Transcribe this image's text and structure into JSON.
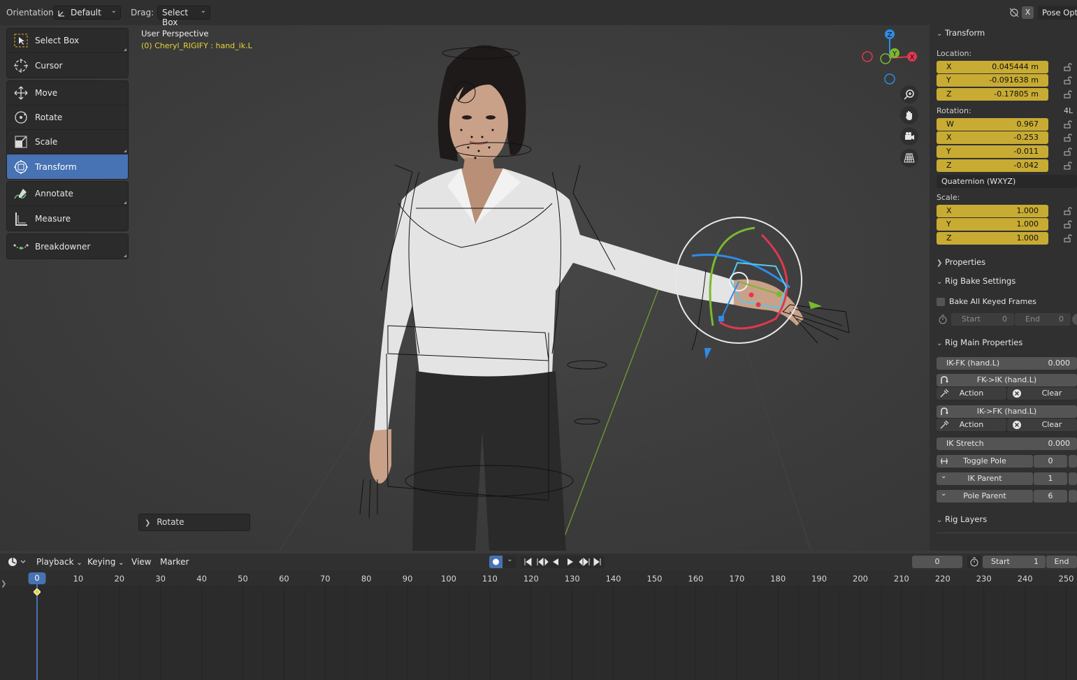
{
  "header": {
    "orientation_label": "Orientation:",
    "orientation_value": "Default",
    "drag_label": "Drag:",
    "drag_value": "Select Box",
    "close_x": "X",
    "pose_options": "Pose Opti"
  },
  "viewport": {
    "view_name": "User Perspective",
    "object_info": "(0) Cheryl_RIGIFY : hand_ik.L",
    "last_operator": "Rotate",
    "gizmo_axes": {
      "x": "X",
      "y": "Y",
      "z": "Z"
    }
  },
  "toolbar": [
    {
      "label": "Select Box",
      "icon": "select-box-icon"
    },
    {
      "label": "Cursor",
      "icon": "cursor-icon"
    },
    {
      "label": "Move",
      "icon": "move-icon"
    },
    {
      "label": "Rotate",
      "icon": "rotate-icon"
    },
    {
      "label": "Scale",
      "icon": "scale-icon"
    },
    {
      "label": "Transform",
      "icon": "transform-icon",
      "active": true
    },
    {
      "label": "Annotate",
      "icon": "annotate-icon"
    },
    {
      "label": "Measure",
      "icon": "measure-icon"
    },
    {
      "label": "Breakdowner",
      "icon": "breakdowner-icon"
    }
  ],
  "sidebar": {
    "transform": {
      "title": "Transform",
      "location_label": "Location:",
      "location": [
        {
          "axis": "X",
          "value": "0.045444 m"
        },
        {
          "axis": "Y",
          "value": "-0.091638 m"
        },
        {
          "axis": "Z",
          "value": "-0.17805 m"
        }
      ],
      "rotation_label": "Rotation:",
      "rotation_lock": "4L",
      "rotation": [
        {
          "axis": "W",
          "value": "0.967"
        },
        {
          "axis": "X",
          "value": "-0.253"
        },
        {
          "axis": "Y",
          "value": "-0.011"
        },
        {
          "axis": "Z",
          "value": "-0.042"
        }
      ],
      "rotation_mode": "Quaternion (WXYZ)",
      "scale_label": "Scale:",
      "scale": [
        {
          "axis": "X",
          "value": "1.000"
        },
        {
          "axis": "Y",
          "value": "1.000"
        },
        {
          "axis": "Z",
          "value": "1.000"
        }
      ]
    },
    "properties_title": "Properties",
    "rig_bake": {
      "title": "Rig Bake Settings",
      "bake_all_label": "Bake All Keyed Frames",
      "start_label": "Start",
      "start_value": "0",
      "end_label": "End",
      "end_value": "0"
    },
    "rig_main": {
      "title": "Rig Main Properties",
      "ikfk_label": "IK-FK (hand.L)",
      "ikfk_value": "0.000",
      "fk_to_ik": "FK->IK (hand.L)",
      "ik_to_fk": "IK->FK (hand.L)",
      "action_label": "Action",
      "clear_label": "Clear",
      "ik_stretch_label": "IK Stretch",
      "ik_stretch_value": "0.000",
      "toggle_pole_label": "Toggle Pole",
      "toggle_pole_value": "0",
      "ik_parent_label": "IK Parent",
      "ik_parent_value": "1",
      "pole_parent_label": "Pole Parent",
      "pole_parent_value": "6"
    },
    "rig_layers_title": "Rig Layers"
  },
  "timeline": {
    "menus": [
      "Playback",
      "Keying",
      "View",
      "Marker"
    ],
    "current_frame": "0",
    "start_label": "Start",
    "start_value": "1",
    "end_label": "End",
    "ruler_ticks": [
      "10",
      "20",
      "30",
      "40",
      "50",
      "60",
      "70",
      "80",
      "90",
      "100",
      "110",
      "120",
      "130",
      "140",
      "150",
      "160",
      "170",
      "180",
      "190",
      "200",
      "210",
      "220",
      "230",
      "240",
      "250"
    ],
    "ruler_current": "0"
  },
  "colors": {
    "accent_blue": "#4772b3",
    "field_yellow": "#c8ab33",
    "object_text_yellow": "#e6d53a",
    "axis_x": "#e0384f",
    "axis_y": "#7cb82f",
    "axis_z": "#2e8ce6"
  }
}
